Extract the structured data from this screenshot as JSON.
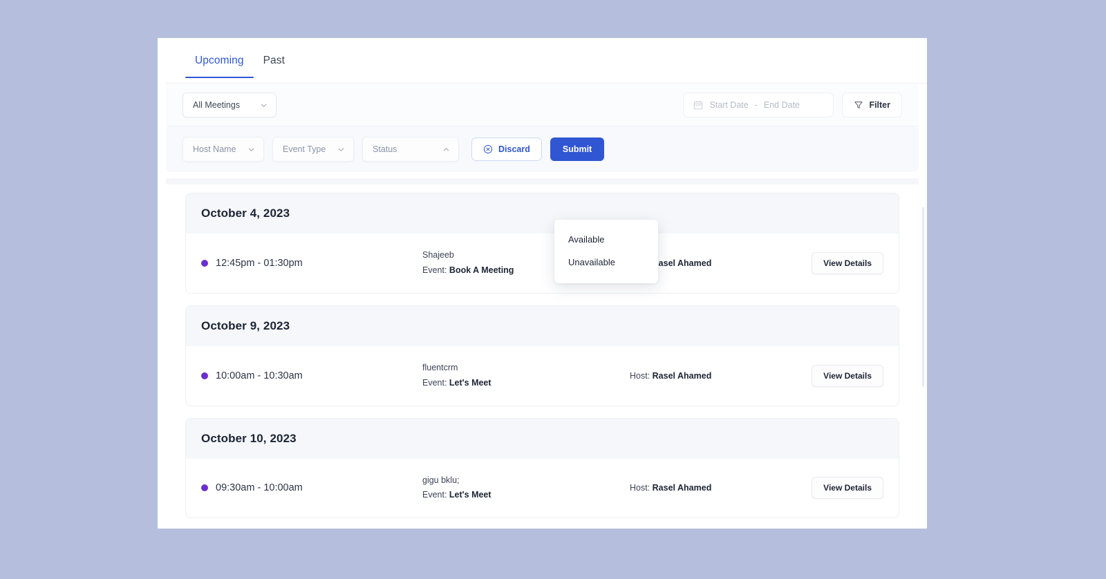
{
  "app": {
    "tabs": [
      {
        "label": "Upcoming",
        "active": true
      },
      {
        "label": "Past",
        "active": false
      }
    ]
  },
  "toolbar": {
    "meeting_filter": {
      "value": "All Meetings",
      "icon": "chevron-down-icon"
    },
    "date_range": {
      "icon": "calendar-icon",
      "start_placeholder": "Start Date",
      "separator": "-",
      "end_placeholder": "End Date"
    },
    "filter_button": {
      "label": "Filter",
      "icon": "funnel-icon"
    }
  },
  "filter_panel": {
    "host_name": {
      "placeholder": "Host Name",
      "icon": "chevron-down-icon"
    },
    "event_type": {
      "placeholder": "Event Type",
      "icon": "chevron-down-icon"
    },
    "status": {
      "placeholder": "Status",
      "icon": "chevron-up-icon",
      "open": true
    },
    "discard_button": {
      "label": "Discard",
      "icon": "circle-x-icon"
    },
    "submit_button": {
      "label": "Submit"
    }
  },
  "status_dropdown": {
    "options": [
      {
        "label": "Available"
      },
      {
        "label": "Unavailable"
      }
    ]
  },
  "meetings": [
    {
      "date": "October 4, 2023",
      "time": "12:45pm - 01:30pm",
      "attendee": "Shajeeb",
      "event_label": "Event: ",
      "event_name": "Book A Meeting",
      "host_label": "Host: ",
      "host_name": "Rasel Ahamed",
      "action_label": "View Details"
    },
    {
      "date": "October 9, 2023",
      "time": "10:00am - 10:30am",
      "attendee": "fluentcrm",
      "event_label": "Event: ",
      "event_name": "Let's Meet",
      "host_label": "Host: ",
      "host_name": "Rasel Ahamed",
      "action_label": "View Details"
    },
    {
      "date": "October 10, 2023",
      "time": "09:30am - 10:00am",
      "attendee": "gigu bklu;",
      "event_label": "Event: ",
      "event_name": "Let's Meet",
      "host_label": "Host: ",
      "host_name": "Rasel Ahamed",
      "action_label": "View Details"
    }
  ],
  "colors": {
    "accent": "#2f55d4",
    "submit": "#3056d3",
    "status_dot": "#6c2fce",
    "page_background": "#b5bedd",
    "card_header": "#f5f7fa"
  }
}
